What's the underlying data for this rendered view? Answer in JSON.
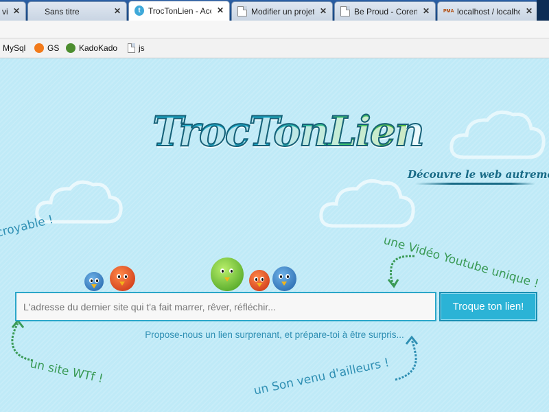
{
  "browser": {
    "tabs": [
      {
        "title": "vi",
        "icon": "document-icon",
        "active": false
      },
      {
        "title": "Sans titre",
        "icon": "none",
        "active": false
      },
      {
        "title": "TrocTonLien - Acc",
        "icon": "troctonlien-favicon",
        "active": true
      },
      {
        "title": "Modifier un projet",
        "icon": "document-icon",
        "active": false
      },
      {
        "title": "Be Proud - Corent",
        "icon": "document-icon",
        "active": false
      },
      {
        "title": "localhost / localho",
        "icon": "phpmyadmin-favicon",
        "active": false
      }
    ],
    "favicon_letter": "t",
    "pma_label": "PMA",
    "close_glyph": "✕",
    "bookmarks": [
      {
        "label": "MySql",
        "icon": "none"
      },
      {
        "label": "GS",
        "icon": "gs-icon"
      },
      {
        "label": "KadoKado",
        "icon": "kadokado-icon"
      },
      {
        "label": "js",
        "icon": "document-icon"
      }
    ]
  },
  "page": {
    "logo": "TrocTonLien",
    "tagline": "Découvre le web autrement.",
    "notes": {
      "left": "ncroyable !",
      "youtube": "une Vidéo Youtube unique !",
      "wtf": "un site WTf !",
      "son": "un Son venu d'ailleurs !"
    },
    "search": {
      "placeholder": "L'adresse du dernier site qui t'a fait marrer, rêver, réfléchir...",
      "value": ""
    },
    "submit_label": "Troque ton lien!",
    "hint": "Propose-nous un lien surprenant, et prépare-toi à être surpris..."
  },
  "colors": {
    "background": "#bfeaf7",
    "accent": "#2bb3d6",
    "text_blue": "#2f8fb3",
    "text_green": "#3a9a56",
    "tab_bar": "#1e4e8c"
  }
}
